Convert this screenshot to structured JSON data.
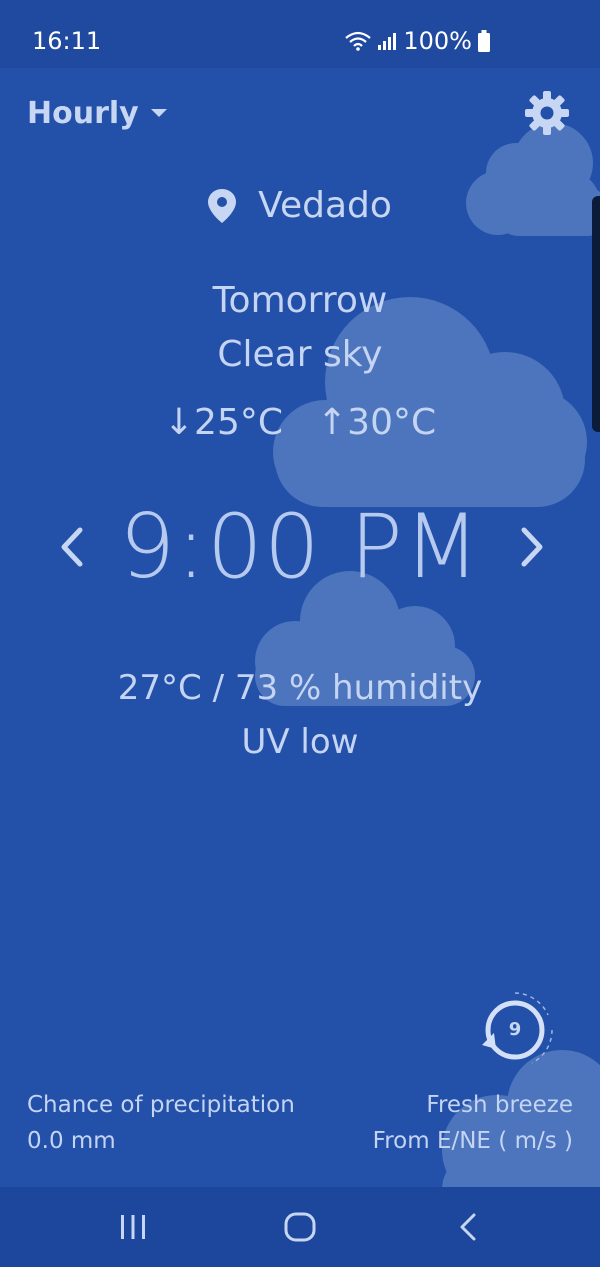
{
  "status_bar": {
    "time": "16:11",
    "battery": "100%"
  },
  "header": {
    "mode_label": "Hourly"
  },
  "location": {
    "name": "Vedado"
  },
  "forecast": {
    "day": "Tomorrow",
    "condition": "Clear sky",
    "low": "↓25°C",
    "high": "↑30°C",
    "time": "9:00 PM",
    "temp_humidity": "27°C / 73 % humidity",
    "uv": "UV low"
  },
  "footer": {
    "precip_label": "Chance of precipitation",
    "precip_value": "0.0 mm",
    "wind_label": "Fresh breeze",
    "wind_direction": "From E/NE ( m/s )",
    "wind_speed": "9"
  },
  "colors": {
    "background": "#2350a8",
    "cloud": "#6e94cf",
    "text": "#c4d4f2"
  }
}
